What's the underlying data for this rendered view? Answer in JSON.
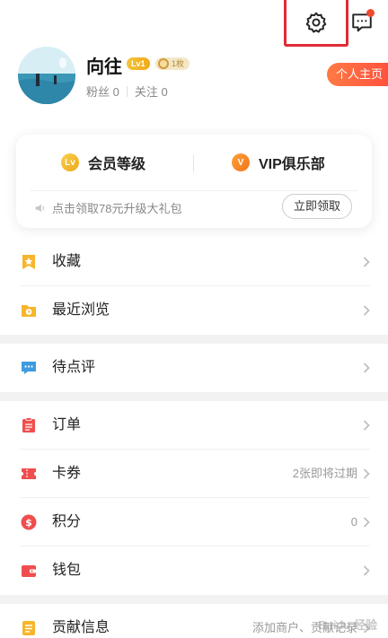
{
  "header": {
    "settings_icon": "gear-icon",
    "message_icon": "chat-bubble-icon",
    "message_badge_color": "#f04b2d"
  },
  "profile": {
    "username": "向往",
    "level_badge": "Lv1",
    "medal_badge": "1枚",
    "fans_label": "粉丝 0",
    "follow_label": "关注 0",
    "homepage_button": "个人主页"
  },
  "member_card": {
    "level_label": "会员等级",
    "level_icon_text": "Lv",
    "vip_label": "VIP俱乐部",
    "vip_icon_text": "V",
    "promo_text": "点击领取78元升级大礼包",
    "claim_button": "立即领取"
  },
  "menu": {
    "favorites": {
      "label": "收藏",
      "icon": "star-bookmark-icon"
    },
    "recent": {
      "label": "最近浏览",
      "icon": "folder-clock-icon"
    },
    "review": {
      "label": "待点评",
      "icon": "comment-icon"
    },
    "orders": {
      "label": "订单",
      "icon": "clipboard-icon"
    },
    "coupons": {
      "label": "卡券",
      "hint": "2张即将过期",
      "icon": "ticket-icon"
    },
    "points": {
      "label": "积分",
      "hint": "0",
      "icon": "dollar-coin-icon"
    },
    "wallet": {
      "label": "钱包",
      "icon": "wallet-icon"
    },
    "contribute": {
      "label": "贡献信息",
      "hint": "添加商户、贡献记录",
      "icon": "document-icon"
    }
  },
  "colors": {
    "accent_red": "#ff4d3c",
    "gold": "#f5c33b",
    "icon_orange": "#f7b52c",
    "icon_blue": "#3f9be0",
    "icon_red": "#f04e4e"
  },
  "watermark": "Baidu 经验"
}
